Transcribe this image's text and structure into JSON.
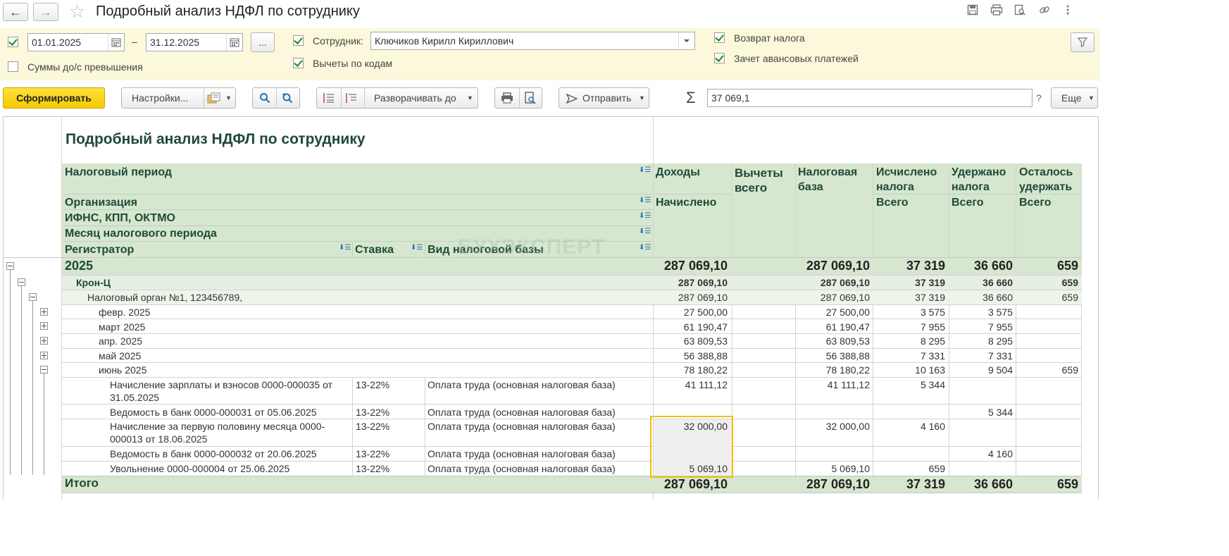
{
  "window": {
    "title": "Подробный анализ НДФЛ по сотруднику",
    "back_icon": "←",
    "forward_icon": "→",
    "favorite_icon": "☆",
    "tool_icons": [
      "💾",
      "🖨",
      "🔍",
      "🔗",
      "⋮",
      "×"
    ]
  },
  "filters": {
    "period_enabled": true,
    "date_from": "01.01.2025",
    "date_to": "31.12.2025",
    "dash": "–",
    "more_label": "...",
    "exceed_label": "Суммы до/с превышения",
    "employee_label": "Сотрудник:",
    "employee_value": "Ключиков Кирилл Кириллович",
    "deductions_by_codes_label": "Вычеты по кодам",
    "tax_refund_label": "Возврат налога",
    "advance_offset_label": "Зачет авансовых платежей",
    "filter_icon": "⛉"
  },
  "toolbar": {
    "generate_label": "Сформировать",
    "settings_label": "Настройки...",
    "expand_label": "Разворачивать до",
    "send_label": "Отправить",
    "sum_symbol": "Σ",
    "sum_value": "37 069,1",
    "help_label": "?",
    "more_label": "Еще"
  },
  "report": {
    "title": "Подробный анализ НДФЛ по сотруднику",
    "watermark": "БУХЭКСПЕРТ",
    "group_headers": {
      "tax_period": "Налоговый период",
      "organization": "Организация",
      "ifns": "ИФНС, КПП, ОКТМО",
      "month": "Месяц налогового периода",
      "registrar": "Регистратор",
      "rate": "Ставка",
      "base_type": "Вид налоговой базы"
    },
    "columns": {
      "income": "Доходы",
      "income_sub": "Начислено",
      "deductions": "Вычеты всего",
      "tax_base": "Налоговая база",
      "calculated": "Исчислено налога",
      "calculated_sub": "Всего",
      "withheld": "Удержано налога",
      "withheld_sub": "Всего",
      "remaining": "Осталось удержать",
      "remaining_sub": "Всего"
    },
    "rows": [
      {
        "label": "2025",
        "income": "287 069,10",
        "base": "287 069,10",
        "calc": "37 319",
        "withheld": "36 660",
        "remain": "659"
      },
      {
        "label": "Крон-Ц",
        "income": "287 069,10",
        "base": "287 069,10",
        "calc": "37 319",
        "withheld": "36 660",
        "remain": "659"
      },
      {
        "label": "Налоговый орган №1, 123456789,",
        "income": "287 069,10",
        "base": "287 069,10",
        "calc": "37 319",
        "withheld": "36 660",
        "remain": "659"
      },
      {
        "label": "февр. 2025",
        "income": "27 500,00",
        "base": "27 500,00",
        "calc": "3 575",
        "withheld": "3 575",
        "remain": ""
      },
      {
        "label": "март 2025",
        "income": "61 190,47",
        "base": "61 190,47",
        "calc": "7 955",
        "withheld": "7 955",
        "remain": ""
      },
      {
        "label": "апр. 2025",
        "income": "63 809,53",
        "base": "63 809,53",
        "calc": "8 295",
        "withheld": "8 295",
        "remain": ""
      },
      {
        "label": "май 2025",
        "income": "56 388,88",
        "base": "56 388,88",
        "calc": "7 331",
        "withheld": "7 331",
        "remain": ""
      },
      {
        "label": "июнь 2025",
        "income": "78 180,22",
        "base": "78 180,22",
        "calc": "10 163",
        "withheld": "9 504",
        "remain": "659"
      },
      {
        "label": "Начисление зарплаты и взносов 0000-000035 от 31.05.2025",
        "rate": "13-22%",
        "type": "Оплата труда (основная налоговая база)",
        "income": "41 111,12",
        "base": "41 111,12",
        "calc": "5 344",
        "withheld": "",
        "remain": ""
      },
      {
        "label": "Ведомость в банк 0000-000031 от 05.06.2025",
        "rate": "13-22%",
        "type": "Оплата труда (основная налоговая база)",
        "income": "",
        "base": "",
        "calc": "",
        "withheld": "5 344",
        "remain": ""
      },
      {
        "label": "Начисление за первую половину месяца 0000-000013 от 18.06.2025",
        "rate": "13-22%",
        "type": "Оплата труда (основная налоговая база)",
        "income": "32 000,00",
        "base": "32 000,00",
        "calc": "4 160",
        "withheld": "",
        "remain": ""
      },
      {
        "label": "Ведомость в банк 0000-000032 от 20.06.2025",
        "rate": "13-22%",
        "type": "Оплата труда (основная налоговая база)",
        "income": "",
        "base": "",
        "calc": "",
        "withheld": "4 160",
        "remain": ""
      },
      {
        "label": "Увольнение 0000-000004 от 25.06.2025",
        "rate": "13-22%",
        "type": "Оплата труда (основная налоговая база)",
        "income": "5 069,10",
        "base": "5 069,10",
        "calc": "659",
        "withheld": "",
        "remain": ""
      }
    ],
    "total": {
      "label": "Итого",
      "income": "287 069,10",
      "base": "287 069,10",
      "calc": "37 319",
      "withheld": "36 660",
      "remain": "659"
    }
  }
}
